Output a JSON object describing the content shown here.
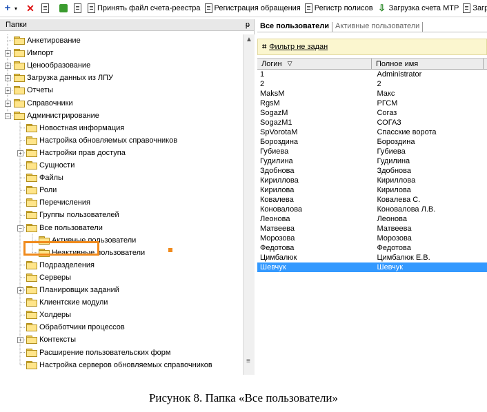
{
  "toolbar": {
    "buttons": [
      {
        "icon": "plus-icon",
        "label": ""
      },
      {
        "icon": "delete-icon",
        "label": ""
      },
      {
        "icon": "copy-icon",
        "label": ""
      },
      {
        "icon": "refresh-icon",
        "label": ""
      },
      {
        "icon": "properties-icon",
        "label": ""
      },
      {
        "icon": "document-icon",
        "label": "Принять файл счета-реестра"
      },
      {
        "icon": "document-icon",
        "label": "Регистрация обращения"
      },
      {
        "icon": "policy-icon",
        "label": "Регистр полисов"
      },
      {
        "icon": "upload-icon",
        "label": "Загрузка счета МТР"
      },
      {
        "icon": "document-icon",
        "label": "Загрузка"
      }
    ]
  },
  "left_panel": {
    "title": "Папки",
    "pin": "ᵽ",
    "tree": [
      {
        "label": "Анкетирование",
        "level": 0,
        "expander": ""
      },
      {
        "label": "Импорт",
        "level": 0,
        "expander": "+"
      },
      {
        "label": "Ценообразование",
        "level": 0,
        "expander": "+"
      },
      {
        "label": "Загрузка данных из ЛПУ",
        "level": 0,
        "expander": "+"
      },
      {
        "label": "Отчеты",
        "level": 0,
        "expander": "+"
      },
      {
        "label": "Справочники",
        "level": 0,
        "expander": "+"
      },
      {
        "label": "Администрирование",
        "level": 0,
        "expander": "−"
      },
      {
        "label": "Новостная информация",
        "level": 1,
        "expander": ""
      },
      {
        "label": "Настройка обновляемых справочников",
        "level": 1,
        "expander": ""
      },
      {
        "label": "Настройки прав доступа",
        "level": 1,
        "expander": "+"
      },
      {
        "label": "Сущности",
        "level": 1,
        "expander": ""
      },
      {
        "label": "Файлы",
        "level": 1,
        "expander": ""
      },
      {
        "label": "Роли",
        "level": 1,
        "expander": ""
      },
      {
        "label": "Перечисления",
        "level": 1,
        "expander": ""
      },
      {
        "label": "Группы пользователей",
        "level": 1,
        "expander": ""
      },
      {
        "label": "Все пользователи",
        "level": 1,
        "expander": "−",
        "highlight": true
      },
      {
        "label": "Активные пользователи",
        "level": 2,
        "expander": ""
      },
      {
        "label": "Неактивные пользователи",
        "level": 2,
        "expander": ""
      },
      {
        "label": "Подразделения",
        "level": 1,
        "expander": ""
      },
      {
        "label": "Серверы",
        "level": 1,
        "expander": ""
      },
      {
        "label": "Планировщик заданий",
        "level": 1,
        "expander": "+"
      },
      {
        "label": "Клиентские модули",
        "level": 1,
        "expander": ""
      },
      {
        "label": "Холдеры",
        "level": 1,
        "expander": ""
      },
      {
        "label": "Обработчики процессов",
        "level": 1,
        "expander": ""
      },
      {
        "label": "Контексты",
        "level": 1,
        "expander": "+"
      },
      {
        "label": "Расширение пользовательских форм",
        "level": 1,
        "expander": ""
      },
      {
        "label": "Настройка серверов обновляемых справочников",
        "level": 1,
        "expander": ""
      }
    ]
  },
  "right_panel": {
    "tabs": [
      "Все пользователи",
      "Активные пользователи"
    ],
    "filter": "Фильтр не задан",
    "columns": [
      "Логин",
      "Полное имя"
    ],
    "rows": [
      [
        "1",
        "Administrator"
      ],
      [
        "2",
        "2"
      ],
      [
        "MaksM",
        "Макс"
      ],
      [
        "RgsM",
        "РГСМ"
      ],
      [
        "SogazM",
        "Согаз"
      ],
      [
        "SogazM1",
        "СОГАЗ"
      ],
      [
        "SpVorotaM",
        "Спасские ворота"
      ],
      [
        "Бороздина",
        "Бороздина"
      ],
      [
        "Губиева",
        "Губиева"
      ],
      [
        "Гудилина",
        "Гудилина"
      ],
      [
        "Здобнова",
        "Здобнова"
      ],
      [
        "Кириллова",
        "Кириллова"
      ],
      [
        "Кирилова",
        "Кирилова"
      ],
      [
        "Ковалева",
        "Ковалева С."
      ],
      [
        "Коновалова",
        "Коновалова Л.В."
      ],
      [
        "Леонова",
        "Леонова"
      ],
      [
        "Матвеева",
        "Матвеева"
      ],
      [
        "Морозова",
        "Морозова"
      ],
      [
        "Федотова",
        "Федотова"
      ],
      [
        "Цимбалюк",
        "Цимбалюк Е.В."
      ],
      [
        "Шевчук",
        "Шевчук"
      ]
    ],
    "selected_row": 20,
    "selection_color": "#3399ff"
  },
  "caption": "Рисунок 8. Папка «Все пользователи»",
  "colors": {
    "highlight_border": "#f08a1c",
    "filter_bg": "#fbf6cf"
  }
}
